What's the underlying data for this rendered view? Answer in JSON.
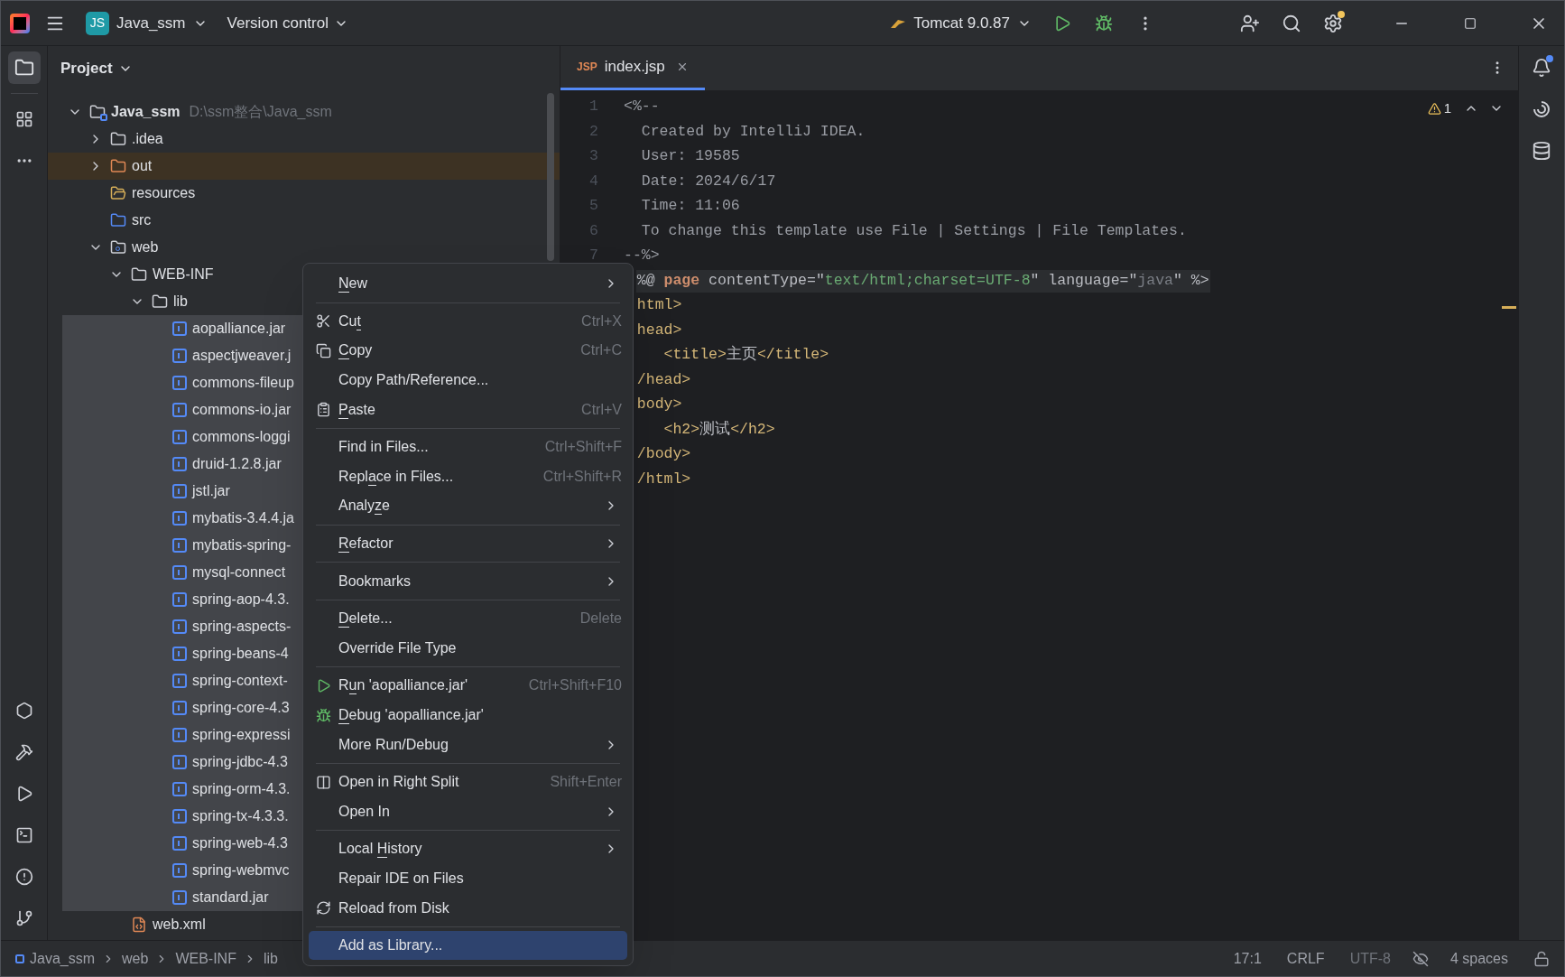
{
  "title_bar": {
    "project_badge": "JS",
    "project": "Java_ssm",
    "vcs": "Version control",
    "run_config": "Tomcat 9.0.87"
  },
  "left_toolbar": {
    "top": [
      {
        "selected": true
      },
      {
        "selected": false
      },
      {
        "selected": false
      }
    ],
    "bottom": [
      {
        "selected": false
      },
      {
        "selected": false
      },
      {
        "selected": false
      },
      {
        "selected": false
      },
      {
        "selected": false
      },
      {
        "selected": false
      }
    ]
  },
  "project_panel": {
    "title": "Project",
    "tree": [
      {
        "label": "Java_ssm",
        "path": "D:\\ssm整合\\Java_ssm",
        "kind": "module",
        "expanded": true,
        "selected": false,
        "children": [
          {
            "label": ".idea",
            "kind": "folder",
            "expanded": false,
            "selected": false
          },
          {
            "label": "out",
            "kind": "excluded",
            "expanded": false,
            "selected": false
          },
          {
            "label": "resources",
            "kind": "resources",
            "selected": false
          },
          {
            "label": "src",
            "kind": "source",
            "selected": false
          },
          {
            "label": "web",
            "kind": "web",
            "expanded": true,
            "selected": false,
            "children": [
              {
                "label": "WEB-INF",
                "kind": "folder",
                "expanded": true,
                "selected": false,
                "children": [
                  {
                    "label": "lib",
                    "kind": "folder",
                    "expanded": true,
                    "selected": false,
                    "children": [
                      {
                        "label": "aopalliance.jar",
                        "kind": "library",
                        "selected": true
                      },
                      {
                        "label": "aspectjweaver.j",
                        "kind": "library",
                        "selected": true
                      },
                      {
                        "label": "commons-fileup",
                        "kind": "library",
                        "selected": true
                      },
                      {
                        "label": "commons-io.jar",
                        "kind": "library",
                        "selected": true
                      },
                      {
                        "label": "commons-loggi",
                        "kind": "library",
                        "selected": true
                      },
                      {
                        "label": "druid-1.2.8.jar",
                        "kind": "library",
                        "selected": true
                      },
                      {
                        "label": "jstl.jar",
                        "kind": "library",
                        "selected": true
                      },
                      {
                        "label": "mybatis-3.4.4.ja",
                        "kind": "library",
                        "selected": true
                      },
                      {
                        "label": "mybatis-spring-",
                        "kind": "library",
                        "selected": true
                      },
                      {
                        "label": "mysql-connect",
                        "kind": "library",
                        "selected": true
                      },
                      {
                        "label": "spring-aop-4.3.",
                        "kind": "library",
                        "selected": true
                      },
                      {
                        "label": "spring-aspects-",
                        "kind": "library",
                        "selected": true
                      },
                      {
                        "label": "spring-beans-4",
                        "kind": "library",
                        "selected": true
                      },
                      {
                        "label": "spring-context-",
                        "kind": "library",
                        "selected": true
                      },
                      {
                        "label": "spring-core-4.3",
                        "kind": "library",
                        "selected": true
                      },
                      {
                        "label": "spring-expressi",
                        "kind": "library",
                        "selected": true
                      },
                      {
                        "label": "spring-jdbc-4.3",
                        "kind": "library",
                        "selected": true
                      },
                      {
                        "label": "spring-orm-4.3.",
                        "kind": "library",
                        "selected": true
                      },
                      {
                        "label": "spring-tx-4.3.3.",
                        "kind": "library",
                        "selected": true
                      },
                      {
                        "label": "spring-web-4.3",
                        "kind": "library",
                        "selected": true
                      },
                      {
                        "label": "spring-webmvc",
                        "kind": "library",
                        "selected": true
                      },
                      {
                        "label": "standard.jar",
                        "kind": "library",
                        "selected": true
                      }
                    ]
                  }
                ]
              },
              {
                "label": "web.xml",
                "kind": "xml",
                "selected": false
              }
            ]
          }
        ]
      }
    ]
  },
  "editor": {
    "tabs": [
      {
        "badge": "JSP",
        "label": "index.jsp",
        "selected": true
      }
    ],
    "warnings": "1",
    "lines": [
      {
        "number": "1",
        "highlighted": false,
        "segments": [
          {
            "t": "<%--",
            "kind": "comment"
          }
        ]
      },
      {
        "number": "2",
        "highlighted": false,
        "segments": [
          {
            "t": "  Created by IntelliJ IDEA.",
            "kind": "comment"
          }
        ]
      },
      {
        "number": "3",
        "highlighted": false,
        "segments": [
          {
            "t": "  User: 19585",
            "kind": "comment"
          }
        ]
      },
      {
        "number": "4",
        "highlighted": false,
        "segments": [
          {
            "t": "  Date: 2024/6/17",
            "kind": "comment"
          }
        ]
      },
      {
        "number": "5",
        "highlighted": false,
        "segments": [
          {
            "t": "  Time: 11:06",
            "kind": "comment"
          }
        ]
      },
      {
        "number": "6",
        "highlighted": false,
        "segments": [
          {
            "t": "  To change this template use File | Settings | File Templates.",
            "kind": "comment"
          }
        ]
      },
      {
        "number": "7",
        "highlighted": false,
        "segments": [
          {
            "t": "--%>",
            "kind": "comment"
          }
        ]
      },
      {
        "highlighted": true,
        "segments": [
          {
            "t": "%@ ",
            "kind": "plain"
          },
          {
            "t": "page",
            "kind": "keyword"
          },
          {
            "t": " contentType=\"",
            "kind": "plain"
          },
          {
            "t": "text/html;charset=UTF-8",
            "kind": "string"
          },
          {
            "t": "\" language=\"",
            "kind": "plain"
          },
          {
            "t": "java",
            "kind": "muted"
          },
          {
            "t": "\" %>",
            "kind": "plain"
          }
        ]
      },
      {
        "highlighted": false,
        "segments": [
          {
            "t": "html>",
            "kind": "tag"
          }
        ]
      },
      {
        "highlighted": false,
        "segments": [
          {
            "t": "head>",
            "kind": "tag"
          }
        ]
      },
      {
        "highlighted": false,
        "segments": [
          {
            "t": "   <title>",
            "kind": "tag"
          },
          {
            "t": "主页",
            "kind": "plain"
          },
          {
            "t": "</title>",
            "kind": "tag"
          }
        ]
      },
      {
        "highlighted": false,
        "segments": [
          {
            "t": "/head>",
            "kind": "tag"
          }
        ]
      },
      {
        "highlighted": false,
        "segments": [
          {
            "t": "body>",
            "kind": "tag"
          }
        ]
      },
      {
        "highlighted": false,
        "segments": [
          {
            "t": "   <h2>",
            "kind": "tag"
          },
          {
            "t": "测试",
            "kind": "plain"
          },
          {
            "t": "</h2>",
            "kind": "tag"
          }
        ]
      },
      {
        "highlighted": false,
        "segments": [
          {
            "t": "/body>",
            "kind": "tag"
          }
        ]
      },
      {
        "highlighted": false,
        "segments": [
          {
            "t": "/html>",
            "kind": "tag"
          }
        ]
      }
    ]
  },
  "context_menu": {
    "groups": [
      [
        {
          "label": [
            {
              "t": "N",
              "underlined": true
            },
            {
              "t": "ew",
              "underlined": false
            }
          ],
          "kind": "plain",
          "submenu": true,
          "selected": false
        }
      ],
      [
        {
          "label": [
            {
              "t": "Cu",
              "underlined": false
            },
            {
              "t": "t",
              "underlined": true
            }
          ],
          "kind": "cut",
          "shortcut": "Ctrl+X",
          "submenu": false,
          "selected": false
        },
        {
          "label": [
            {
              "t": "C",
              "underlined": true
            },
            {
              "t": "opy",
              "underlined": false
            }
          ],
          "kind": "copy",
          "shortcut": "Ctrl+C",
          "submenu": false,
          "selected": false
        },
        {
          "label": [
            {
              "t": "Copy Path/Reference...",
              "underlined": false
            }
          ],
          "kind": "plain",
          "submenu": false,
          "selected": false
        },
        {
          "label": [
            {
              "t": "P",
              "underlined": true
            },
            {
              "t": "aste",
              "underlined": false
            }
          ],
          "kind": "paste",
          "shortcut": "Ctrl+V",
          "submenu": false,
          "selected": false
        }
      ],
      [
        {
          "label": [
            {
              "t": "Find in Files...",
              "underlined": false
            }
          ],
          "kind": "plain",
          "shortcut": "Ctrl+Shift+F",
          "submenu": false,
          "selected": false
        },
        {
          "label": [
            {
              "t": "Repl",
              "underlined": false
            },
            {
              "t": "a",
              "underlined": true
            },
            {
              "t": "ce in Files...",
              "underlined": false
            }
          ],
          "kind": "plain",
          "shortcut": "Ctrl+Shift+R",
          "submenu": false,
          "selected": false
        },
        {
          "label": [
            {
              "t": "Analy",
              "underlined": false
            },
            {
              "t": "z",
              "underlined": true
            },
            {
              "t": "e",
              "underlined": false
            }
          ],
          "kind": "plain",
          "submenu": true,
          "selected": false
        }
      ],
      [
        {
          "label": [
            {
              "t": "R",
              "underlined": true
            },
            {
              "t": "efactor",
              "underlined": false
            }
          ],
          "kind": "plain",
          "submenu": true,
          "selected": false
        }
      ],
      [
        {
          "label": [
            {
              "t": "Bookmarks",
              "underlined": false
            }
          ],
          "kind": "plain",
          "submenu": true,
          "selected": false
        }
      ],
      [
        {
          "label": [
            {
              "t": "D",
              "underlined": true
            },
            {
              "t": "elete...",
              "underlined": false
            }
          ],
          "kind": "plain",
          "shortcut": "Delete",
          "submenu": false,
          "selected": false
        },
        {
          "label": [
            {
              "t": "Override File Type",
              "underlined": false
            }
          ],
          "kind": "plain",
          "submenu": false,
          "selected": false
        }
      ],
      [
        {
          "label": [
            {
              "t": "R",
              "underlined": false
            },
            {
              "t": "u",
              "underlined": true
            },
            {
              "t": "n 'aopalliance.jar'",
              "underlined": false
            }
          ],
          "kind": "run",
          "shortcut": "Ctrl+Shift+F10",
          "submenu": false,
          "selected": false
        },
        {
          "label": [
            {
              "t": "D",
              "underlined": true
            },
            {
              "t": "ebug 'aopalliance.jar'",
              "underlined": false
            }
          ],
          "kind": "debug",
          "submenu": false,
          "selected": false
        },
        {
          "label": [
            {
              "t": "More Run/Debug",
              "underlined": false
            }
          ],
          "kind": "plain",
          "submenu": true,
          "selected": false
        }
      ],
      [
        {
          "label": [
            {
              "t": "Open in Right Split",
              "underlined": false
            }
          ],
          "kind": "split",
          "shortcut": "Shift+Enter",
          "submenu": false,
          "selected": false
        },
        {
          "label": [
            {
              "t": "Open In",
              "underlined": false
            }
          ],
          "kind": "plain",
          "submenu": true,
          "selected": false
        }
      ],
      [
        {
          "label": [
            {
              "t": "Local ",
              "underlined": false
            },
            {
              "t": "H",
              "underlined": true
            },
            {
              "t": "istory",
              "underlined": false
            }
          ],
          "kind": "plain",
          "submenu": true,
          "selected": false
        },
        {
          "label": [
            {
              "t": "Repair IDE on Files",
              "underlined": false
            }
          ],
          "kind": "plain",
          "submenu": false,
          "selected": false
        },
        {
          "label": [
            {
              "t": "Reload from Disk",
              "underlined": false
            }
          ],
          "kind": "reload",
          "submenu": false,
          "selected": false
        }
      ],
      [
        {
          "label": [
            {
              "t": "Add as Library...",
              "underlined": false
            }
          ],
          "kind": "plain",
          "submenu": false,
          "selected": true
        }
      ]
    ]
  },
  "status_bar": {
    "breadcrumbs": [
      "Java_ssm",
      "web",
      "WEB-INF",
      "lib"
    ],
    "position": "17:1",
    "line_separator": "CRLF",
    "encoding": "UTF-8",
    "indent": "4 spaces"
  }
}
